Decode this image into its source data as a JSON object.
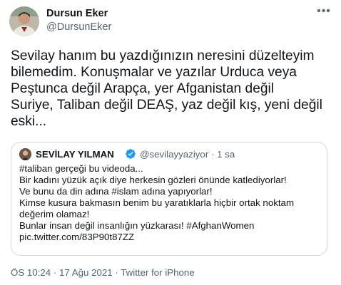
{
  "author": {
    "display_name": "Dursun Eker",
    "handle": "@DursunEker"
  },
  "more_icon": "more-horizontal-icon",
  "tweet": {
    "text": "Sevilay hanım bu yazdığınızın neresini düzelteyim bilemedim. Konuşmalar ve yazılar Urduca veya Peştunca değil Arapça, yer Afganistan değil Suriye, Taliban değil DEAŞ, yaz değil kış, yeni değil eski...",
    "lines": [
      "Sevilay hanım bu yazdığınızın neresini düzelteyim",
      "bilemedim. Konuşmalar ve yazılar Urduca veya",
      "Peştunca değil Arapça, yer Afganistan değil",
      "Suriye, Taliban değil DEAŞ, yaz değil kış, yeni değil",
      "eski..."
    ]
  },
  "quoted": {
    "display_name": "SEVİLAY YILMAN",
    "verified_icon": "verified-badge-icon",
    "handle_time": "@sevilayyaziyor · 1 sa",
    "lines": [
      "#taliban gerçeği bu videoda...",
      "Bir kadını yüzük açık diye herkesin gözleri önünde katlediyorlar!",
      "Ve bunu da din adına #islam adına yapıyorlar!",
      "Kimse kusura bakmasın benim bu yaratıklarla hiçbir ortak noktam",
      "değerim olamaz!",
      "Bunlar insan değil insanlığın yüzkarası! #AfghanWomen",
      "pic.twitter.com/83P90t87ZZ"
    ]
  },
  "meta": {
    "text": "ÖS 10:24 · 17 Ağu 2021 · Twitter for iPhone"
  },
  "colors": {
    "text_primary": "#0f1419",
    "text_secondary": "#536471",
    "border": "#cfd9de",
    "verified": "#1d9bf0"
  }
}
